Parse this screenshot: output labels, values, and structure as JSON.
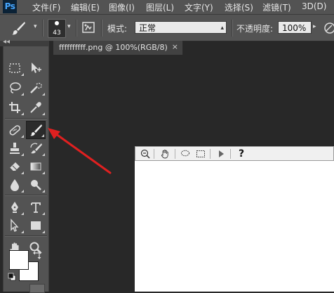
{
  "app": {
    "logo": "Ps"
  },
  "menu": [
    {
      "label": "文件(F)"
    },
    {
      "label": "编辑(E)"
    },
    {
      "label": "图像(I)"
    },
    {
      "label": "图层(L)"
    },
    {
      "label": "文字(Y)"
    },
    {
      "label": "选择(S)"
    },
    {
      "label": "滤镜(T)"
    },
    {
      "label": "3D(D)"
    }
  ],
  "options": {
    "brush_size": "43",
    "mode_label": "模式:",
    "mode_value": "正常",
    "opacity_label": "不透明度:",
    "opacity_value": "100%"
  },
  "document": {
    "tab_title": "ffffffffff.png @ 100%(RGB/8)",
    "close_glyph": "×"
  },
  "toolbar": {
    "collapse_glyph": "◂◂",
    "active_tool": "brush-tool"
  },
  "floating_toolbar": {
    "help_glyph": "?"
  },
  "annotation": {
    "color": "#e02020"
  }
}
